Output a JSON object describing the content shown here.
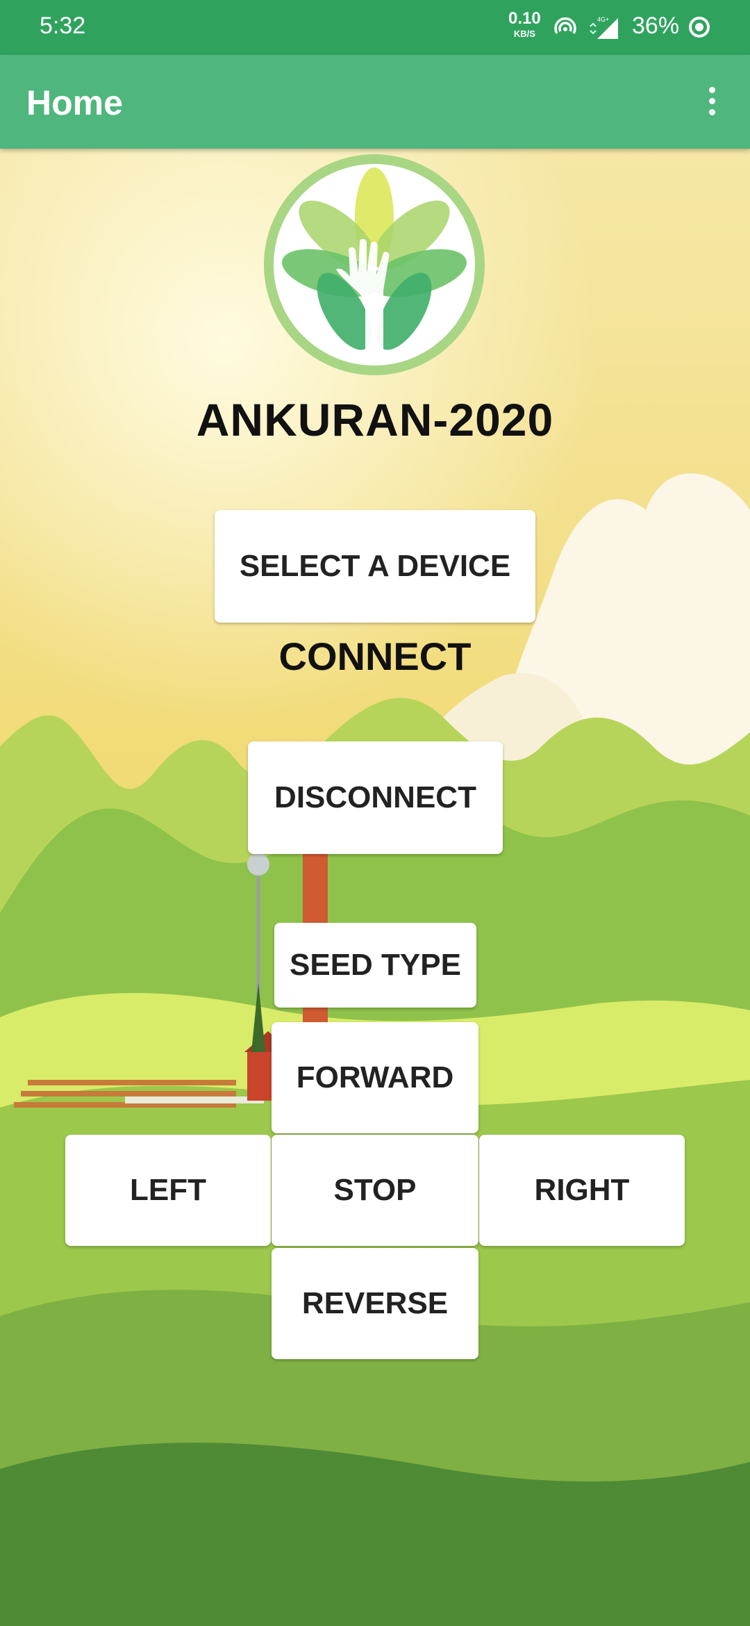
{
  "status_bar": {
    "time": "5:32",
    "speed_value": "0.10",
    "speed_unit": "KB/S",
    "network": "4G+",
    "battery": "36%"
  },
  "app_bar": {
    "title": "Home"
  },
  "main": {
    "app_title": "ANKURAN-2020",
    "select_device_label": "SELECT A DEVICE",
    "connect_label": "CONNECT",
    "disconnect_label": "DISCONNECT",
    "seed_type_label": "SEED TYPE",
    "forward_label": "FORWARD",
    "left_label": "LEFT",
    "stop_label": "STOP",
    "right_label": "RIGHT",
    "reverse_label": "REVERSE"
  },
  "colors": {
    "status_bar": "#2fa35e",
    "app_bar": "#4fb67d",
    "button_bg": "#ffffff"
  },
  "icons": [
    "hotspot-icon",
    "signal-icon",
    "battery-icon",
    "overflow-menu-icon",
    "leaf-hand-logo-icon"
  ]
}
